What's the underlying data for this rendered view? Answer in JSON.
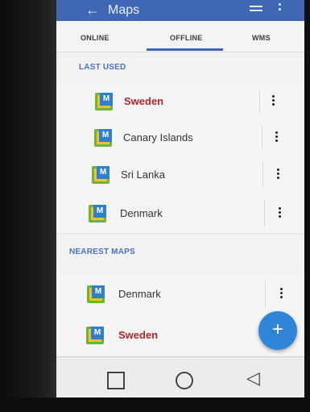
{
  "toolbar": {
    "title": "Maps",
    "back_icon": "arrow-left-icon",
    "list_icon": "list-icon",
    "more_icon": "more-vert-icon"
  },
  "tabs": [
    {
      "label": "ONLINE"
    },
    {
      "label": "OFFLINE"
    },
    {
      "label": "WMS"
    }
  ],
  "selected_tab": "OFFLINE",
  "sections": {
    "last_used": "LAST USED",
    "nearest_maps": "NEAREST MAPS"
  },
  "last_used": [
    {
      "label": "Sweden",
      "highlighted": true
    },
    {
      "label": "Canary Islands",
      "highlighted": false
    },
    {
      "label": "Sri Lanka",
      "highlighted": false
    },
    {
      "label": "Denmark",
      "highlighted": false
    }
  ],
  "nearest_maps": [
    {
      "label": "Denmark",
      "highlighted": false
    },
    {
      "label": "Sweden",
      "highlighted": true
    }
  ],
  "logo_text": "M",
  "fab": {
    "label": "+"
  },
  "navbar": {
    "recents": "square-icon",
    "home": "circle-icon",
    "back": "triangle-back-icon"
  },
  "colors": {
    "accent": "#3f67b3",
    "highlight_text": "#b3252c",
    "fab": "#2f86d8"
  }
}
